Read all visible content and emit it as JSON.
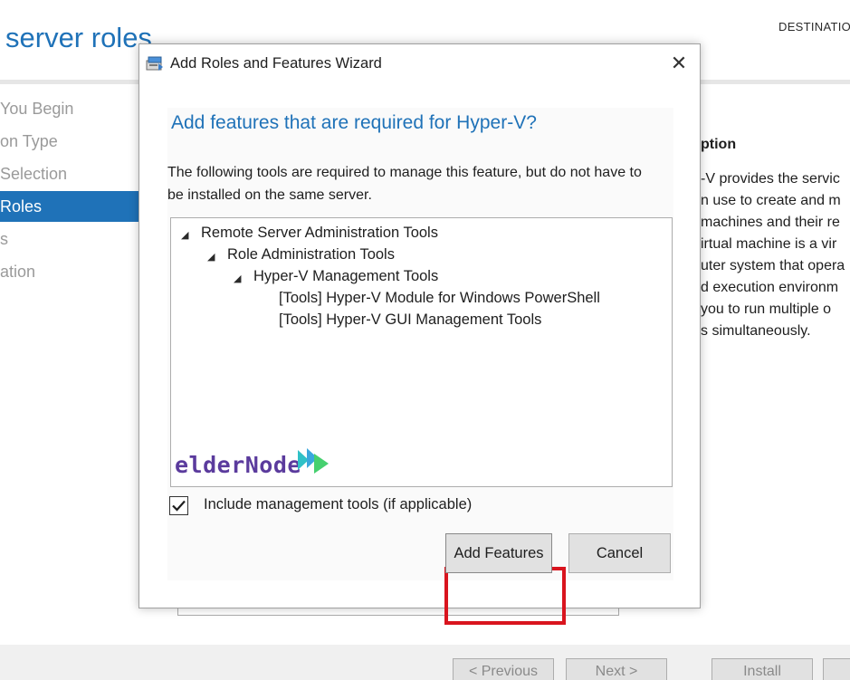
{
  "background": {
    "page_title": "server roles",
    "destination_label": "DESTINATIO",
    "nav_items": [
      {
        "label": "You Begin",
        "active": false
      },
      {
        "label": "on Type",
        "active": false
      },
      {
        "label": "Selection",
        "active": false
      },
      {
        "label": "Roles",
        "active": true
      },
      {
        "label": "s",
        "active": false
      },
      {
        "label": "ation",
        "active": false
      }
    ],
    "description_heading": "ption",
    "description_lines": [
      "-V provides the servic",
      "n use to create and m",
      "machines and their re",
      "irtual machine is a vir",
      "uter system that opera",
      "d execution environm",
      "you to run multiple o",
      "s simultaneously."
    ],
    "footer_buttons": {
      "previous": "< Previous",
      "next": "Next >",
      "install": "Install"
    }
  },
  "dialog": {
    "title": "Add Roles and Features Wizard",
    "close_glyph": "✕",
    "heading": "Add features that are required for Hyper-V?",
    "description": "The following tools are required to manage this feature, but do not have to be installed on the same server.",
    "tree": [
      {
        "label": "Remote Server Administration Tools",
        "level": 0,
        "expanded": true
      },
      {
        "label": "Role Administration Tools",
        "level": 1,
        "expanded": true
      },
      {
        "label": "Hyper-V Management Tools",
        "level": 2,
        "expanded": true
      },
      {
        "label": "[Tools] Hyper-V Module for Windows PowerShell",
        "level": 3
      },
      {
        "label": "[Tools] Hyper-V GUI Management Tools",
        "level": 3
      }
    ],
    "watermark": "elderNode",
    "include_tools_label": "Include management tools (if applicable)",
    "include_tools_checked": true,
    "add_button": "Add Features",
    "cancel_button": "Cancel",
    "highlight_color": "#d9141e",
    "accent_color": "#1f72b8"
  }
}
